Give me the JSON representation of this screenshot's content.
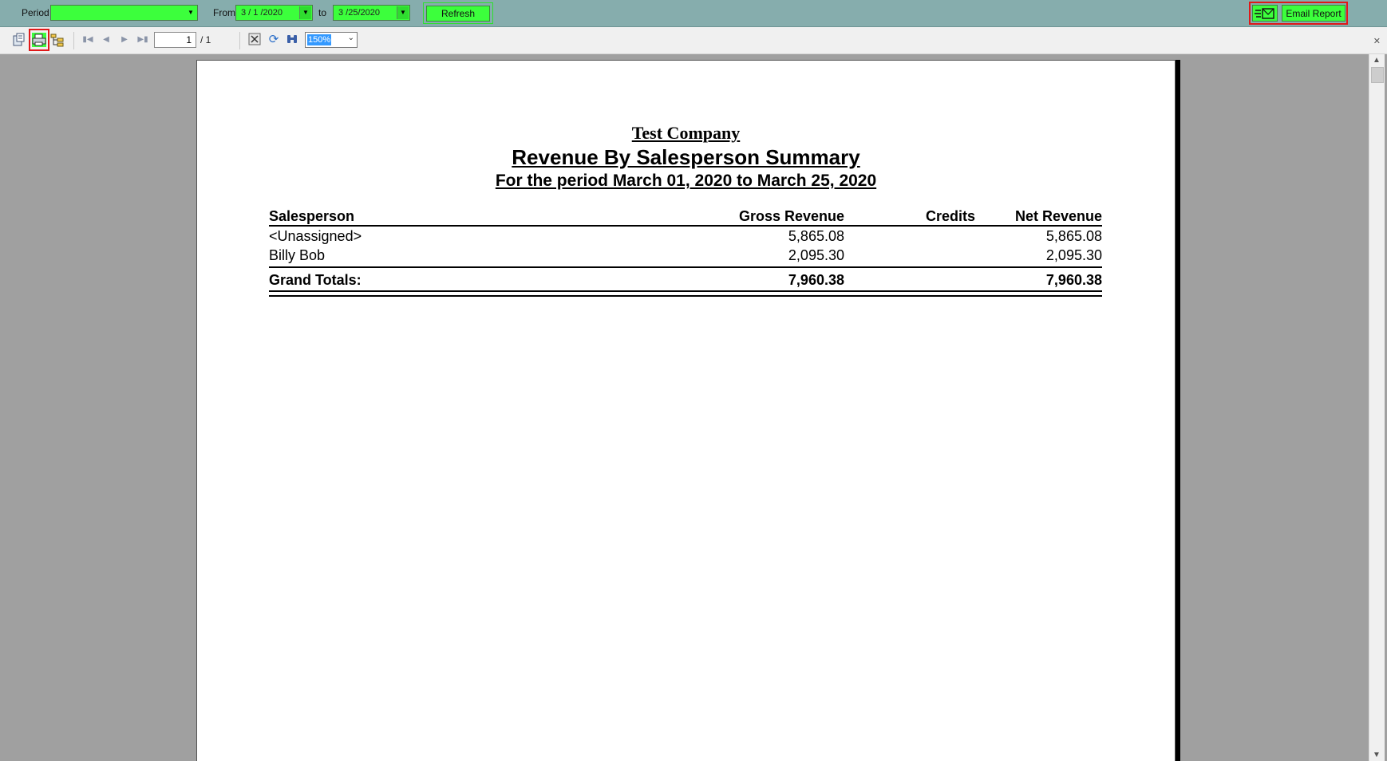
{
  "filters": {
    "period_label": "Period",
    "period_value": "",
    "from_label": "From",
    "from_value": "3 / 1 /2020",
    "to_label": "to",
    "to_value": "3 /25/2020",
    "refresh_label": "Refresh",
    "email_label": "Email Report"
  },
  "toolbar": {
    "page_current": "1",
    "page_total": "/ 1",
    "zoom_value": "150%"
  },
  "report": {
    "company": "Test Company",
    "title": "Revenue By Salesperson Summary",
    "subtitle": "For the period March 01, 2020 to March 25, 2020",
    "columns": [
      "Salesperson",
      "Gross Revenue",
      "Credits",
      "Net Revenue"
    ],
    "rows": [
      {
        "salesperson": "<Unassigned>",
        "gross": "5,865.08",
        "credits": "",
        "net": "5,865.08"
      },
      {
        "salesperson": "Billy Bob",
        "gross": "2,095.30",
        "credits": "",
        "net": "2,095.30"
      }
    ],
    "totals": {
      "label": "Grand Totals:",
      "gross": "7,960.38",
      "credits": "",
      "net": "7,960.38"
    }
  },
  "colors": {
    "filter_bar": "#86adad",
    "highlight_green": "#3cff3c",
    "highlight_red": "#e01818"
  }
}
